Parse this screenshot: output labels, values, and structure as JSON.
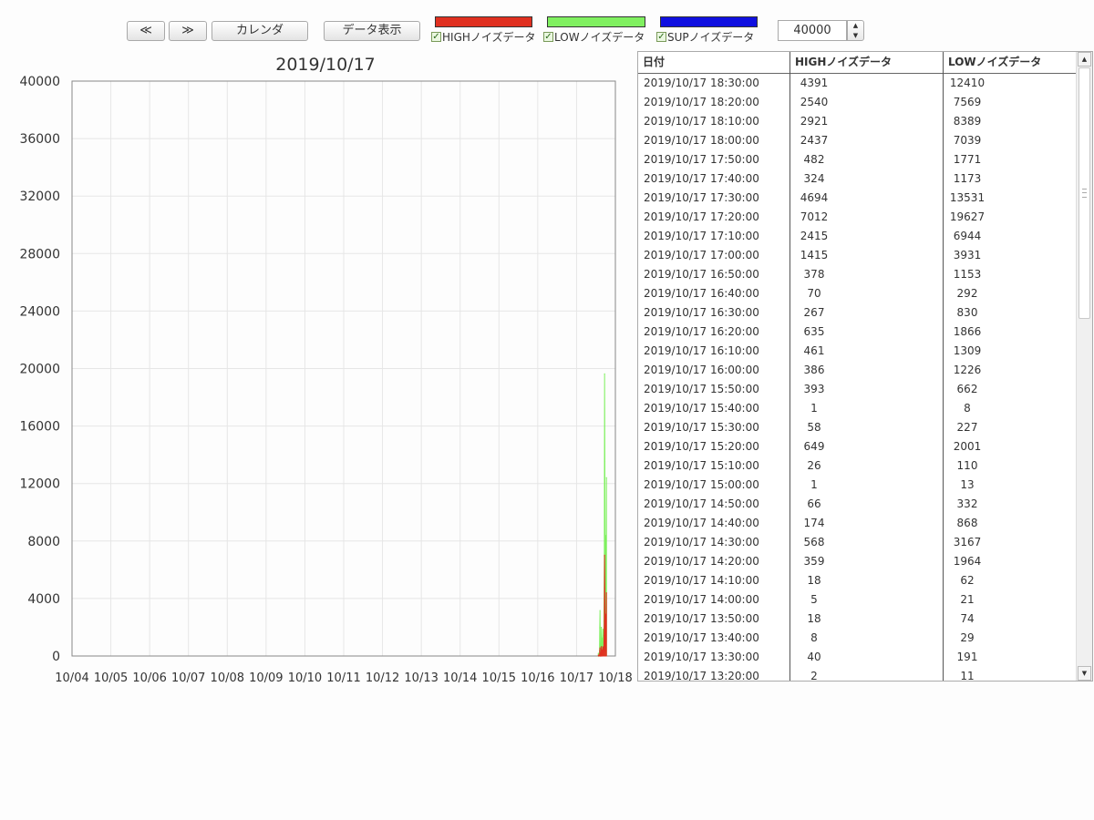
{
  "toolbar": {
    "prev_label": "≪",
    "next_label": "≫",
    "calendar_label": "カレンダ",
    "show_data_label": "データ表示",
    "legend": [
      {
        "label": "HIGHノイズデータ",
        "color": "#e03020",
        "checked": true
      },
      {
        "label": "LOWノイズデータ",
        "color": "#80f060",
        "checked": true
      },
      {
        "label": "SUPノイズデータ",
        "color": "#1010e0",
        "checked": true
      }
    ],
    "check_mark": "✓",
    "max_value": "40000",
    "spin_up": "▲",
    "spin_down": "▼"
  },
  "chart_data": {
    "type": "area",
    "title": "2019/10/17",
    "xlabel": "",
    "ylabel": "",
    "x_ticks": [
      "10/04",
      "10/05",
      "10/06",
      "10/07",
      "10/08",
      "10/09",
      "10/10",
      "10/11",
      "10/12",
      "10/13",
      "10/14",
      "10/15",
      "10/16",
      "10/17",
      "10/18"
    ],
    "y_ticks": [
      0,
      4000,
      8000,
      12000,
      16000,
      20000,
      24000,
      28000,
      32000,
      36000,
      40000
    ],
    "xlim": [
      "2019/10/04 00:00",
      "2019/10/18 00:00"
    ],
    "ylim": [
      0,
      40000
    ],
    "grid": true,
    "series": [
      {
        "name": "LOWノイズデータ",
        "color": "#80f060",
        "points": [
          [
            "2019/10/17 13:30",
            191
          ],
          [
            "2019/10/17 13:40",
            29
          ],
          [
            "2019/10/17 13:50",
            74
          ],
          [
            "2019/10/17 14:00",
            21
          ],
          [
            "2019/10/17 14:10",
            62
          ],
          [
            "2019/10/17 14:20",
            1964
          ],
          [
            "2019/10/17 14:30",
            3167
          ],
          [
            "2019/10/17 14:40",
            868
          ],
          [
            "2019/10/17 14:50",
            332
          ],
          [
            "2019/10/17 15:00",
            13
          ],
          [
            "2019/10/17 15:10",
            110
          ],
          [
            "2019/10/17 15:20",
            2001
          ],
          [
            "2019/10/17 15:30",
            227
          ],
          [
            "2019/10/17 15:40",
            8
          ],
          [
            "2019/10/17 15:50",
            662
          ],
          [
            "2019/10/17 16:00",
            1226
          ],
          [
            "2019/10/17 16:10",
            1309
          ],
          [
            "2019/10/17 16:20",
            1866
          ],
          [
            "2019/10/17 16:30",
            830
          ],
          [
            "2019/10/17 16:40",
            292
          ],
          [
            "2019/10/17 16:50",
            1153
          ],
          [
            "2019/10/17 17:00",
            3931
          ],
          [
            "2019/10/17 17:10",
            6944
          ],
          [
            "2019/10/17 17:20",
            19627
          ],
          [
            "2019/10/17 17:30",
            13531
          ],
          [
            "2019/10/17 17:40",
            1173
          ],
          [
            "2019/10/17 17:50",
            1771
          ],
          [
            "2019/10/17 18:00",
            7039
          ],
          [
            "2019/10/17 18:10",
            8389
          ],
          [
            "2019/10/17 18:20",
            7569
          ],
          [
            "2019/10/17 18:30",
            12410
          ]
        ]
      },
      {
        "name": "HIGHノイズデータ",
        "color": "#e03020",
        "points": [
          [
            "2019/10/17 13:30",
            40
          ],
          [
            "2019/10/17 13:40",
            8
          ],
          [
            "2019/10/17 13:50",
            18
          ],
          [
            "2019/10/17 14:00",
            5
          ],
          [
            "2019/10/17 14:10",
            18
          ],
          [
            "2019/10/17 14:20",
            359
          ],
          [
            "2019/10/17 14:30",
            568
          ],
          [
            "2019/10/17 14:40",
            174
          ],
          [
            "2019/10/17 14:50",
            66
          ],
          [
            "2019/10/17 15:00",
            1
          ],
          [
            "2019/10/17 15:10",
            26
          ],
          [
            "2019/10/17 15:20",
            649
          ],
          [
            "2019/10/17 15:30",
            58
          ],
          [
            "2019/10/17 15:40",
            1
          ],
          [
            "2019/10/17 15:50",
            393
          ],
          [
            "2019/10/17 16:00",
            386
          ],
          [
            "2019/10/17 16:10",
            461
          ],
          [
            "2019/10/17 16:20",
            635
          ],
          [
            "2019/10/17 16:30",
            267
          ],
          [
            "2019/10/17 16:40",
            70
          ],
          [
            "2019/10/17 16:50",
            378
          ],
          [
            "2019/10/17 17:00",
            1415
          ],
          [
            "2019/10/17 17:10",
            2415
          ],
          [
            "2019/10/17 17:20",
            7012
          ],
          [
            "2019/10/17 17:30",
            4694
          ],
          [
            "2019/10/17 17:40",
            324
          ],
          [
            "2019/10/17 17:50",
            482
          ],
          [
            "2019/10/17 18:00",
            2437
          ],
          [
            "2019/10/17 18:10",
            2921
          ],
          [
            "2019/10/17 18:20",
            2540
          ],
          [
            "2019/10/17 18:30",
            4391
          ]
        ]
      }
    ]
  },
  "table": {
    "headers": [
      "日付",
      "HIGHノイズデータ",
      "LOWノイズデータ"
    ],
    "rows": [
      [
        "2019/10/17 18:30:00",
        "4391",
        "12410"
      ],
      [
        "2019/10/17 18:20:00",
        "2540",
        "7569"
      ],
      [
        "2019/10/17 18:10:00",
        "2921",
        "8389"
      ],
      [
        "2019/10/17 18:00:00",
        "2437",
        "7039"
      ],
      [
        "2019/10/17 17:50:00",
        "482",
        "1771"
      ],
      [
        "2019/10/17 17:40:00",
        "324",
        "1173"
      ],
      [
        "2019/10/17 17:30:00",
        "4694",
        "13531"
      ],
      [
        "2019/10/17 17:20:00",
        "7012",
        "19627"
      ],
      [
        "2019/10/17 17:10:00",
        "2415",
        "6944"
      ],
      [
        "2019/10/17 17:00:00",
        "1415",
        "3931"
      ],
      [
        "2019/10/17 16:50:00",
        "378",
        "1153"
      ],
      [
        "2019/10/17 16:40:00",
        "70",
        "292"
      ],
      [
        "2019/10/17 16:30:00",
        "267",
        "830"
      ],
      [
        "2019/10/17 16:20:00",
        "635",
        "1866"
      ],
      [
        "2019/10/17 16:10:00",
        "461",
        "1309"
      ],
      [
        "2019/10/17 16:00:00",
        "386",
        "1226"
      ],
      [
        "2019/10/17 15:50:00",
        "393",
        "662"
      ],
      [
        "2019/10/17 15:40:00",
        "1",
        "8"
      ],
      [
        "2019/10/17 15:30:00",
        "58",
        "227"
      ],
      [
        "2019/10/17 15:20:00",
        "649",
        "2001"
      ],
      [
        "2019/10/17 15:10:00",
        "26",
        "110"
      ],
      [
        "2019/10/17 15:00:00",
        "1",
        "13"
      ],
      [
        "2019/10/17 14:50:00",
        "66",
        "332"
      ],
      [
        "2019/10/17 14:40:00",
        "174",
        "868"
      ],
      [
        "2019/10/17 14:30:00",
        "568",
        "3167"
      ],
      [
        "2019/10/17 14:20:00",
        "359",
        "1964"
      ],
      [
        "2019/10/17 14:10:00",
        "18",
        "62"
      ],
      [
        "2019/10/17 14:00:00",
        "5",
        "21"
      ],
      [
        "2019/10/17 13:50:00",
        "18",
        "74"
      ],
      [
        "2019/10/17 13:40:00",
        "8",
        "29"
      ],
      [
        "2019/10/17 13:30:00",
        "40",
        "191"
      ],
      [
        "2019/10/17 13:20:00",
        "2",
        "11"
      ]
    ]
  },
  "scrollbar": {
    "up": "▲",
    "down": "▼"
  }
}
